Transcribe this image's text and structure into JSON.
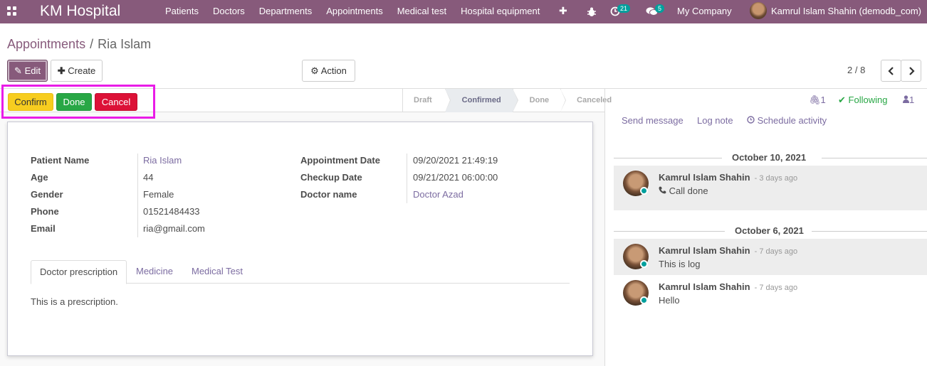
{
  "navbar": {
    "brand": "KM Hospital",
    "menu": [
      "Patients",
      "Doctors",
      "Departments",
      "Appointments",
      "Medical test",
      "Hospital equipment"
    ],
    "activity_count": "21",
    "message_count": "5",
    "company": "My Company",
    "user": "Kamrul Islam Shahin (demodb_com)"
  },
  "breadcrumb": {
    "parent": "Appointments",
    "separator": "/",
    "current": "Ria Islam"
  },
  "control": {
    "edit_label": "Edit",
    "create_label": "Create",
    "action_label": "Action",
    "pager": "2 / 8"
  },
  "statusbar": {
    "confirm_label": "Confirm",
    "done_label": "Done",
    "cancel_label": "Cancel",
    "stages": [
      "Draft",
      "Confirmed",
      "Done",
      "Canceled"
    ],
    "active_stage": "Confirmed"
  },
  "form": {
    "left": [
      {
        "label": "Patient Name",
        "value": "Ria Islam",
        "link": true
      },
      {
        "label": "Age",
        "value": "44"
      },
      {
        "label": "Gender",
        "value": "Female"
      },
      {
        "label": "Phone",
        "value": "01521484433"
      },
      {
        "label": "Email",
        "value": "ria@gmail.com"
      }
    ],
    "right": [
      {
        "label": "Appointment Date",
        "value": "09/20/2021 21:49:19"
      },
      {
        "label": "Checkup Date",
        "value": "09/21/2021 06:00:00"
      },
      {
        "label": "Doctor name",
        "value": "Doctor Azad",
        "link": true
      }
    ],
    "tabs": [
      "Doctor prescription",
      "Medicine",
      "Medical Test"
    ],
    "active_tab": "Doctor prescription",
    "tab_content": "This is a prescription."
  },
  "chatter": {
    "attachments": "1",
    "following": "Following",
    "followers": "1",
    "send_message": "Send message",
    "log_note": "Log note",
    "schedule_activity": "Schedule activity",
    "groups": [
      {
        "date": "October 10, 2021",
        "messages": [
          {
            "author": "Kamrul Islam Shahin",
            "ago": "- 3 days ago",
            "body": "Call done",
            "icon": "phone-icon"
          }
        ]
      },
      {
        "date": "October 6, 2021",
        "messages": [
          {
            "author": "Kamrul Islam Shahin",
            "ago": "- 7 days ago",
            "body": "This is log"
          },
          {
            "author": "Kamrul Islam Shahin",
            "ago": "- 7 days ago",
            "body": "Hello"
          }
        ]
      }
    ]
  },
  "colors": {
    "brand": "#875a7b",
    "confirm": "#f7cd1f",
    "done": "#28a745",
    "cancel": "#dc1137",
    "highlight": "#e91ce7",
    "online": "#00a09d"
  }
}
